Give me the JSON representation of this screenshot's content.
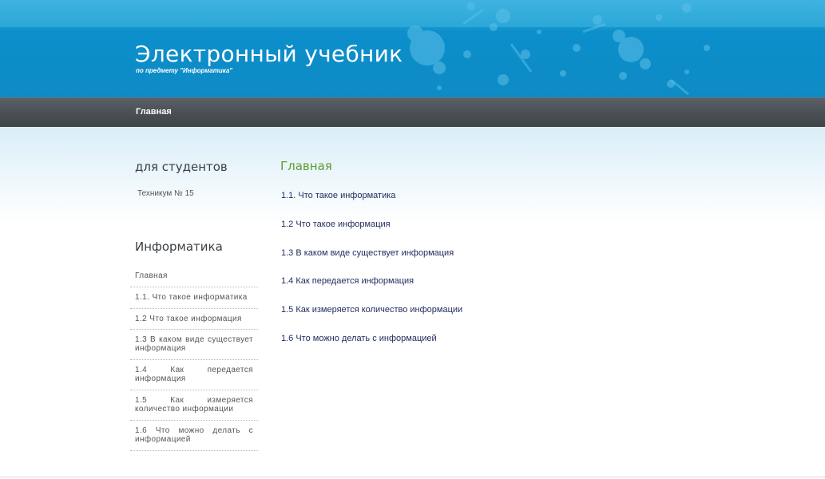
{
  "header": {
    "title": "Электронный учебник",
    "subtitle": "по предмету \"Информатика\"",
    "colors": {
      "band": "#0e8bc5",
      "top": "#3fb3e0"
    }
  },
  "nav": {
    "items": [
      {
        "label": "Главная"
      }
    ]
  },
  "sidebar": {
    "students_heading": "для студентов",
    "students_text": "Техникум № 15",
    "subject_heading": "Информатика",
    "items": [
      {
        "label": "Главная"
      },
      {
        "label": "1.1. Что такое информатика"
      },
      {
        "label": "1.2 Что такое информация"
      },
      {
        "label": "1.3 В каком виде существует информация"
      },
      {
        "label": "1.4 Как передается информация"
      },
      {
        "label": "1.5 Как измеряется количество информации"
      },
      {
        "label": "1.6 Что можно делать с информацией"
      }
    ]
  },
  "main": {
    "title": "Главная",
    "title_color": "#5f9b2f",
    "links": [
      {
        "label": "1.1. Что такое информатика"
      },
      {
        "label": "1.2 Что такое информация"
      },
      {
        "label": "1.3 В каком виде существует информация"
      },
      {
        "label": "1.4 Как передается информация"
      },
      {
        "label": "1.5 Как измеряется количество информации"
      },
      {
        "label": "1.6 Что можно делать с информацией"
      }
    ]
  }
}
